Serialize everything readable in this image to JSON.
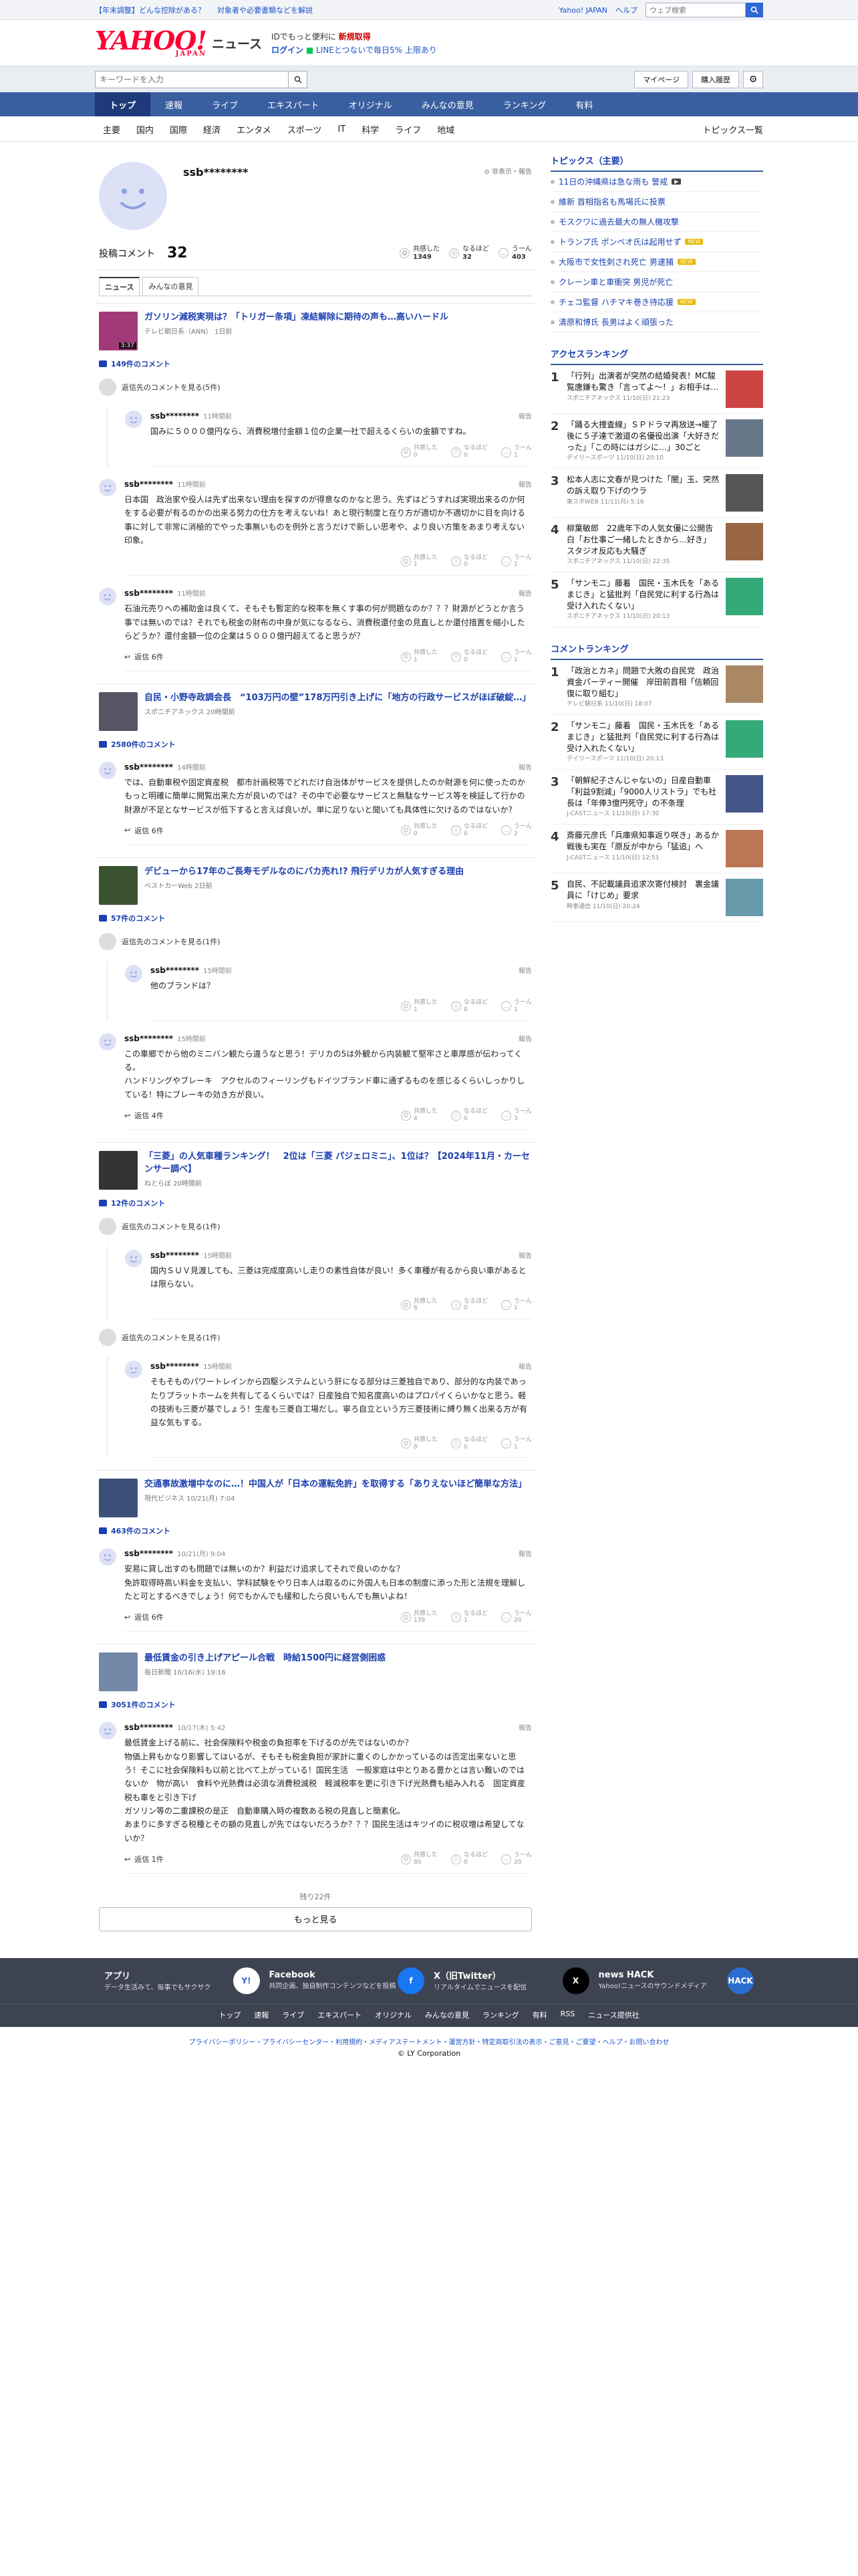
{
  "topline": {
    "promo1": "【年末調整】どんな控除がある？",
    "promo2": "対象者や必要書類などを解説",
    "links": [
      "Yahoo! JAPAN",
      "ヘルプ"
    ],
    "search_placeholder": "ウェブ検索"
  },
  "brand": {
    "logo": "YAHOO!",
    "logo_sub": "JAPAN",
    "service": "ニュース",
    "line1_prefix": "IDでもっと便利に",
    "line1_bold": "新規取得",
    "login": "ログイン",
    "line2": "LINEとつないで毎日5%",
    "line2_bold": "上限あり"
  },
  "searchbar": {
    "placeholder": "キーワードを入力",
    "mypage": "マイページ",
    "purchase": "購入履歴"
  },
  "nav_main": [
    "トップ",
    "速報",
    "ライブ",
    "エキスパート",
    "オリジナル",
    "みんなの意見",
    "ランキング",
    "有料"
  ],
  "nav_sub": [
    "主要",
    "国内",
    "国際",
    "経済",
    "エンタメ",
    "スポーツ",
    "IT",
    "科学",
    "ライフ",
    "地域"
  ],
  "nav_sub_last": "トピックス一覧",
  "profile": {
    "name": "ssb********",
    "report": "非表示・報告",
    "comments_label": "投稿コメント",
    "comments_count": "32",
    "react1_label": "共感した",
    "react1": "1349",
    "react2_label": "なるほど",
    "react2": "32",
    "react3_label": "うーん",
    "react3": "403"
  },
  "tabs": [
    "ニュース",
    "みんなの意見"
  ],
  "articles": [
    {
      "title": "ガソリン減税実現は？「トリガー条項」凍結解除に期待の声も…高いハードル",
      "meta": "テレビ朝日系（ANN） 1日前",
      "duration": "3:37",
      "count": "149件のコメント",
      "replies_label": "返信先のコメントを見る(5件)",
      "comments": [
        {
          "name": "ssb********",
          "time": "11時間前",
          "text": "国みに５０００億円なら、消費税増付金額１位の企業一社で超えるくらいの金額ですね。",
          "r1": "0",
          "r2": "0",
          "r3": "1",
          "nested": true
        },
        {
          "name": "ssb********",
          "time": "11時間前",
          "text": "日本国　政治家や役人は先ず出来ない理由を探すのが得意なのかなと思う。先ずはどうすれば実現出来るのか何をする必要が有るのかの出来る努力の仕方を考えないね！あと現行制度と在り方が適切か不適切かに目を向ける事に対して非常に消極的でやった事無いものを例外と言うだけで新しい思考や、より良い方策をあまり考えない印象。",
          "r1": "1",
          "r2": "0",
          "r3": "1"
        },
        {
          "name": "ssb********",
          "time": "11時間前",
          "text": "石油元売りへの補助金は良くて、そもそも暫定的な税率を無くす事の何が問題なのか？？？財源がどうとか言う事では無いのでは？それでも税金の財布の中身が気になるなら、消費税還付金の見直しとか還付措置を縮小したらどうか？還付金額一位の企業は５０００億円超えてると思うが？",
          "r1": "1",
          "r2": "0",
          "r3": "1",
          "reply": "返信 6件"
        }
      ]
    },
    {
      "title": "自民・小野寺政調会長　“103万円の壁”178万円引き上げに「地方の行政サービスがほぼ破綻…」",
      "meta": "スポニチアネックス 20時間前",
      "count": "2580件のコメント",
      "comments": [
        {
          "name": "ssb********",
          "time": "14時間前",
          "text": "では、自動車税や固定資産税　都市計画税等でどれだけ自治体がサービスを提供したのか財源を何に使ったのかもっと明確に簡単に開覧出来た方が良いのでは？その中で必要なサービスと無駄なサービス等を検証して行かの財源が不足となサービスが低下すると言えば良いが。単に足りないと聞いても具体性に欠けるのではないか？",
          "r1": "0",
          "r2": "0",
          "r3": "2",
          "reply": "返信 6件"
        }
      ]
    },
    {
      "title": "デビューから17年のご長寿モデルなのにバカ売れ!? 飛行デリカが人気すぎる理由",
      "meta": "ベストカーWeb 2日前",
      "count": "57件のコメント",
      "replies_label": "返信先のコメントを見る(1件)",
      "comments": [
        {
          "name": "ssb********",
          "time": "15時間前",
          "text": "他のブランドは？",
          "r1": "1",
          "r2": "0",
          "r3": "1",
          "nested": true
        },
        {
          "name": "ssb********",
          "time": "15時間前",
          "text": "この車郷でから他のミニバン観たら違うなと思う！デリカの5は外観から内装観て堅牢さと車厚感が伝わってくる。\nハンドリングやブレーキ　アクセルのフィーリングもドイツブランド車に通ずるものを感じるくらいしっかりしている！特にブレーキの効き方が良い。",
          "r1": "4",
          "r2": "0",
          "r3": "3",
          "reply": "返信 4件"
        }
      ]
    },
    {
      "title": "「三菱」の人気車種ランキング！　2位は「三菱 パジェロミニ」、1位は？【2024年11月・カーセンサー調べ】",
      "meta": "ねとらぼ 20時間前",
      "count": "12件のコメント",
      "replies_label": "返信先のコメントを見る(1件)",
      "replies_label2": "返信先のコメントを見る(1件)",
      "comments": [
        {
          "name": "ssb********",
          "time": "15時間前",
          "text": "国内ＳＵＶ見渡しても、三菱は完成度高いし走りの素性自体が良い！多く車種が有るから良い車があるとは限らない。",
          "r1": "6",
          "r2": "0",
          "r3": "1",
          "nested": true
        },
        {
          "name": "ssb********",
          "time": "15時間前",
          "text": "そもそものパワートレインから四駆システムという肝になる部分は三菱独自であり、部分的な内装であったりプラットホームを共有してるくらいでは？日産独自で知名度高いのはプロパイくらいかなと思う。軽の技術も三菱が基でしょう！生産も三菱自工場だし。寧ろ自立という方三菱技術に縛り無く出来る方が有益な気もする。",
          "r1": "8",
          "r2": "0",
          "r3": "1",
          "nested": true
        }
      ]
    },
    {
      "title": "交通事故激増中なのに…！中国人が「日本の運転免許」を取得する「ありえないほど簡単な方法」",
      "meta": "現代ビジネス 10/21(月) 7:04",
      "count": "463件のコメント",
      "comments": [
        {
          "name": "ssb********",
          "time": "10/21(月) 9:04",
          "text": "安易に貸し出すのも問題では無いのか？利益だけ追求してそれで良いのかな？\n免許取得時高い料金を支払い、学科試験をやり日本人は取るのに外国人も日本の制度に添った形と法規を理解したと可とするべきでしょう！何でもかんでも緩和したら良いもんでも無いよね！",
          "r1": "139",
          "r2": "1",
          "r3": "20",
          "reply": "返信 6件"
        }
      ]
    },
    {
      "title": "最低賃金の引き上げアピール合戦　時給1500円に経営側困惑",
      "meta": "毎日新聞 10/16(水) 19:16",
      "count": "3051件のコメント",
      "comments": [
        {
          "name": "ssb********",
          "time": "10/17(木) 5:42",
          "text": "最低賃金上げる前に、社会保険料や税金の負担率を下げるのが先ではないのか？\n物価上昇もかなり影響してはいるが、そもそも税金負担が家計に重くのしかかっているのは否定出来ないと思う！そこに社会保険料も以前と比べて上がっている！国民生活　一般家庭は中とりある豊かとは言い難いのではないか　物が高い　食料や光熱費は必須な消費税減税　軽減税率を更に引き下げ光熱費も組み入れる　固定資産税も車をと引き下げ\nガソリン等の二重課税の是正　自動車購入時の複数ある税の見直しと簡素化。\nあまりに多すぎる税種とその額の見直しが先ではないだろうか？？？国民生活はキツイのに税収増は希望してないか？",
          "r1": "80",
          "r2": "0",
          "r3": "20",
          "reply": "返信 1件"
        }
      ]
    }
  ],
  "more": {
    "remaining": "残り22件",
    "label": "もっと見る"
  },
  "side": {
    "topics_title": "トピックス（主要）",
    "topics": [
      {
        "t": "11日の沖縄県は急な雨も 警戒",
        "b": "v"
      },
      {
        "t": "維新 首相指名も馬場氏に投票",
        "b": ""
      },
      {
        "t": "モスクワに過去最大の無人機攻撃",
        "b": ""
      },
      {
        "t": "トランプ氏 ポンペオ氏は起用せず",
        "b": "new"
      },
      {
        "t": "大阪市で女性刺され死亡 男逮捕",
        "b": "new"
      },
      {
        "t": "クレーン車と車衝突 男児が死亡",
        "b": ""
      },
      {
        "t": "チェコ監督 ハチマキ巻き待応援",
        "b": "new"
      },
      {
        "t": "清原和博氏 長男はよく頑張った",
        "b": ""
      }
    ],
    "access_title": "アクセスランキング",
    "access": [
      {
        "n": "1",
        "t": "「行列」出演者が突然の結婚発表！MC駿覧唐鎌も驚き「言ってよ～！」お相手は…",
        "s": "スポニチアネックス 11/10(日) 21:23",
        "c": "#c44"
      },
      {
        "n": "2",
        "t": "「踊る大捜査線」ＳＰドラマ再放送→暖了後に５子達で激道の名優役出演「大好きだった」「この時にはガシに…」30ごと",
        "s": "デイリースポーツ 11/10(日) 20:10",
        "c": "#678"
      },
      {
        "n": "3",
        "t": "松本人志に文春が見つけた「闇」玉、突然の訴え取り下げのウラ",
        "s": "東スポWEB 11/11(月) 5:16",
        "c": "#555"
      },
      {
        "n": "4",
        "t": "柳葉敏郎　22歳年下の人気女優に公開告白「お仕事ご一緒したときから…好き」　スタジオ反応も大騒ぎ",
        "s": "スポニチアネックス 11/10(日) 22:35",
        "c": "#964"
      },
      {
        "n": "5",
        "t": "「サンモニ」藤着　国民・玉木氏を「あるまじき」と猛批判「自民党に利する行為は受け入れたくない」",
        "s": "スポニチアネックス 11/10(日) 20:13",
        "c": "#3a7"
      }
    ],
    "comment_title": "コメントランキング",
    "cranks": [
      {
        "n": "1",
        "t": "「政治とカネ」問題で大敗の自民党　政治資金パーティー開催　岸田前首相「信頼回復に取り組む」",
        "s": "テレビ朝日系 11/10(日) 18:07",
        "c": "#a86"
      },
      {
        "n": "2",
        "t": "「サンモニ」藤着　国民・玉木氏を「あるまじき」と猛批判「自民党に利する行為は受け入れたくない」",
        "s": "デイリースポーツ 11/10(日) 20:13",
        "c": "#3a7"
      },
      {
        "n": "3",
        "t": "「朝鮮紀子さんじゃないの」日産自動車「利益9割減」「9000人リストラ」でも社長は「年俸3億円死守」の不条理",
        "s": "J-CASTニュース 11/10(日) 17:30",
        "c": "#458"
      },
      {
        "n": "4",
        "t": "斎藤元彦氏「兵庫県知事返り咲き」あるか　戦後も実在「原反が中から「猛追」へ",
        "s": "J-CASTニュース 11/10(日) 12:51",
        "c": "#b75"
      },
      {
        "n": "5",
        "t": "自民、不記載議員追求次寄付検討　裏金議員に「けじめ」要求",
        "s": "時事通信 11/10(日) 20:24",
        "c": "#69a"
      }
    ]
  },
  "footer": {
    "services": [
      {
        "name": "アプリ",
        "desc": "データ生活みて、毎事でもサクサク",
        "icon": "Y!"
      },
      {
        "name": "Facebook",
        "desc": "共同企画、独自制作コンテンツなどを投稿",
        "icon": "f"
      },
      {
        "name": "X（旧Twitter）",
        "desc": "リアルタイムでニュースを配信",
        "icon": "X"
      },
      {
        "name": "news HACK",
        "desc": "Yahoo!ニュースのサウンドメディア",
        "icon": "HACK"
      }
    ],
    "nav": [
      "トップ",
      "速報",
      "ライブ",
      "エキスパート",
      "オリジナル",
      "みんなの意見",
      "ランキング",
      "有料",
      "RSS",
      "ニュース提供社"
    ],
    "legal": "プライバシーポリシー・プライバシーセンター・利用規約・メディアステートメント・運営方針・特定商取引法の表示・ご意見・ご要望・ヘルプ・お問い合わせ",
    "copyright": "© LY Corporation"
  }
}
